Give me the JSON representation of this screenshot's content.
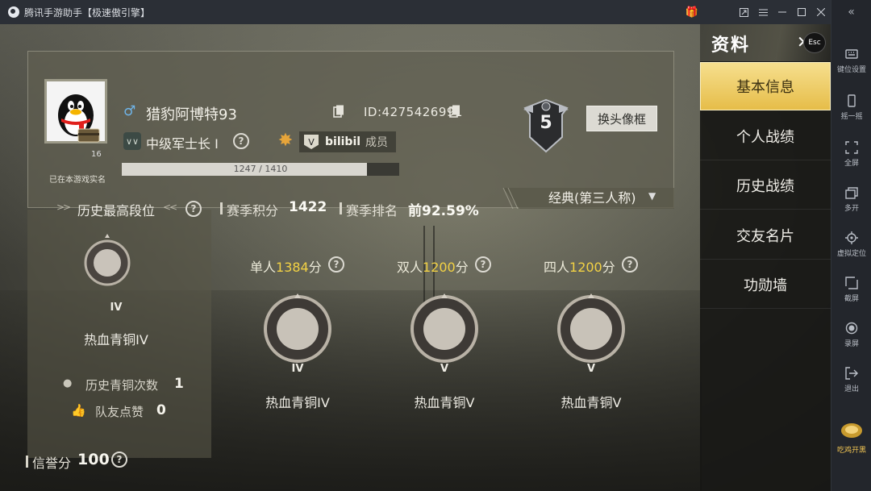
{
  "window": {
    "title": "腾讯手游助手【极速傲引擎】",
    "controls": [
      "gift-icon",
      "popout-icon",
      "menu-icon",
      "minimize-icon",
      "maximize-icon",
      "close-icon"
    ]
  },
  "emulator_sidebar": {
    "items": [
      {
        "label": "键位设置",
        "icon": "keyboard-icon"
      },
      {
        "label": "摇一摇",
        "icon": "shake-icon"
      },
      {
        "label": "全屏",
        "icon": "fullscreen-icon"
      },
      {
        "label": "多开",
        "icon": "multi-window-icon"
      },
      {
        "label": "虚拟定位",
        "icon": "location-icon"
      },
      {
        "label": "截屏",
        "icon": "screenshot-icon"
      },
      {
        "label": "录屏",
        "icon": "record-icon"
      },
      {
        "label": "退出",
        "icon": "exit-icon"
      },
      {
        "label": "吃鸡开黑",
        "icon": "pubg-icon"
      }
    ]
  },
  "profile": {
    "avatar_level": "16",
    "realname_note": "已在本游戏实名",
    "nickname": "猎豹阿博特93",
    "uid": "ID:4275426991",
    "rank_title": "中级军士长 I",
    "clan_name": "bilibil",
    "clan_role": "成员",
    "clan_badge": "V",
    "xp_text": "1247 / 1410",
    "xp_current": 1247,
    "xp_max": 1410,
    "tier_level": "5",
    "change_frame_label": "换头像框"
  },
  "season": {
    "mode_label": "经典(第三人称)",
    "history_title": "历史最高段位",
    "history_badge_roman": "IV",
    "history_badge_name": "热血青铜IV",
    "history_count_label": "历史青铜次数",
    "history_count_value": "1",
    "likes_label": "队友点赞",
    "likes_value": "0",
    "points_label": "赛季积分",
    "points_value": "1422",
    "rank_label": "赛季排名",
    "rank_value": "前92.59%",
    "modes": [
      {
        "prefix": "单人",
        "points": "1384",
        "suffix": "分",
        "roman": "IV",
        "name": "热血青铜IV"
      },
      {
        "prefix": "双人",
        "points": "1200",
        "suffix": "分",
        "roman": "V",
        "name": "热血青铜Ⅴ"
      },
      {
        "prefix": "四人",
        "points": "1200",
        "suffix": "分",
        "roman": "V",
        "name": "热血青铜Ⅴ"
      }
    ]
  },
  "credit": {
    "label": "信誉分",
    "value": "100"
  },
  "menu": {
    "title": "资料",
    "esc_label": "Esc",
    "items": [
      "基本信息",
      "个人战绩",
      "历史战绩",
      "交友名片",
      "功勋墙"
    ],
    "active_index": 0
  }
}
